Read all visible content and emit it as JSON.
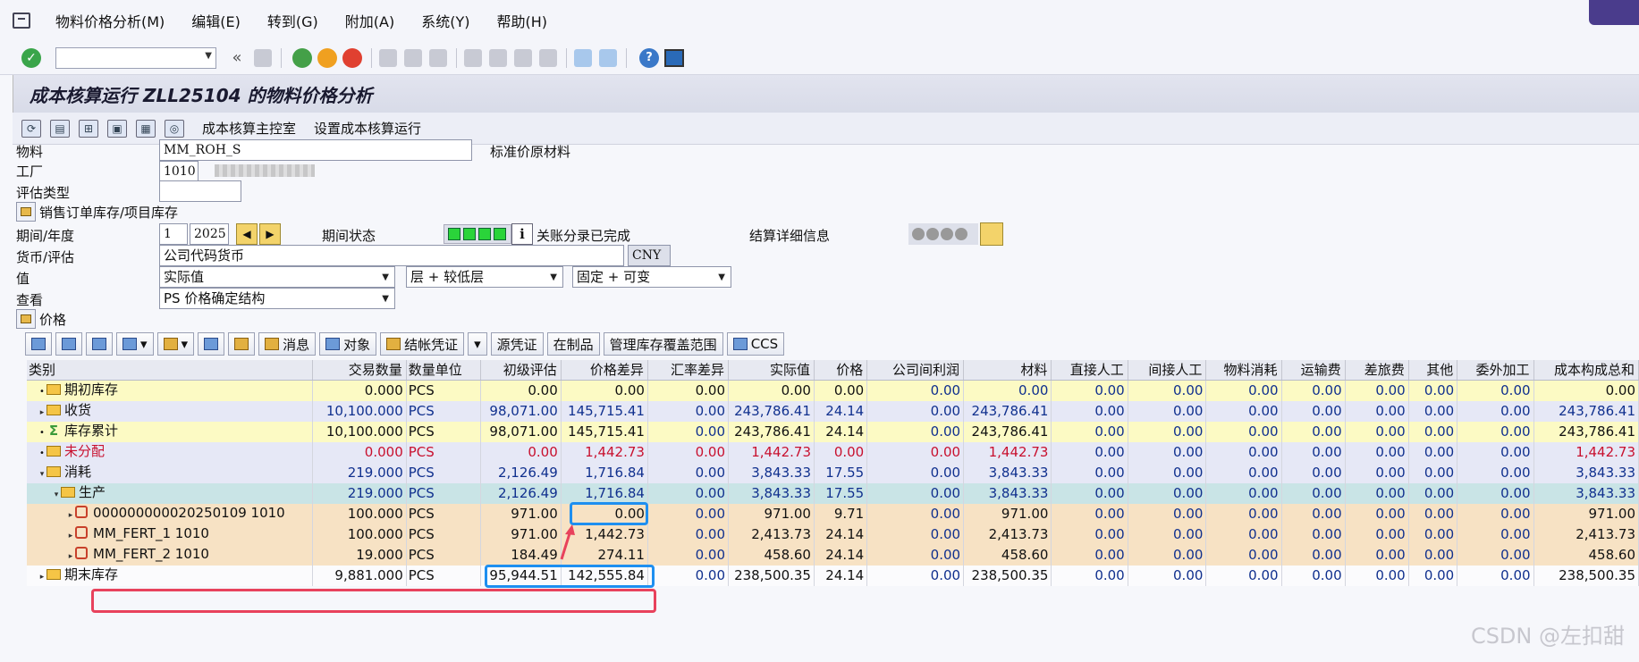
{
  "menubar": {
    "items": [
      "物料价格分析(M)",
      "编辑(E)",
      "转到(G)",
      "附加(A)",
      "系统(Y)",
      "帮助(H)"
    ]
  },
  "toolbar": {
    "back_symbol": "«"
  },
  "title": "成本核算运行 ZLL25104 的物料价格分析",
  "app_toolbar": {
    "cockpit": "成本核算主控室",
    "setup": "设置成本核算运行"
  },
  "form": {
    "material_label": "物料",
    "material_value": "MM_ROH_S",
    "material_desc": "标准价原材料",
    "plant_label": "工厂",
    "plant_value": "1010",
    "valuation_type_label": "评估类型",
    "valuation_type_value": "",
    "sales_order_stock": "销售订单库存/项目库存",
    "period_label": "期间/年度",
    "period_value": "1",
    "year_value": "2025",
    "period_status_label": "期间状态",
    "period_status_text": "关账分录已完成",
    "settlement_label": "结算详细信息",
    "currency_label": "货币/评估",
    "currency_value": "公司代码货币",
    "currency_code": "CNY",
    "value_label": "值",
    "value_select": "实际值",
    "level_select": "层 + 较低层",
    "fixvar_select": "固定 + 可变",
    "view_label": "查看",
    "view_select": "PS 价格确定结构",
    "price_node": "价格"
  },
  "alv_toolbar": {
    "messages": "消息",
    "objects": "对象",
    "settlement_doc": "结帐凭证",
    "source_doc": "源凭证",
    "wip": "在制品",
    "coverage": "管理库存覆盖范围",
    "ccs": "CCS"
  },
  "table": {
    "headers": [
      "类别",
      "交易数量",
      "数量单位",
      "初级评估",
      "价格差异",
      "汇率差异",
      "实际值",
      "价格",
      "公司间利润",
      "材料",
      "直接人工",
      "间接人工",
      "物料消耗",
      "运输费",
      "差旅费",
      "其他",
      "委外加工",
      "成本构成总和"
    ],
    "rows": [
      {
        "name": "期初库存",
        "qty": "0.000",
        "unit": "PCS",
        "prim": "0.00",
        "pdiff": "0.00",
        "xdiff": "0.00",
        "actual": "0.00",
        "price": "0.00",
        "ic": "0.00",
        "mat": "0.00",
        "dl": "0.00",
        "il": "0.00",
        "mc": "0.00",
        "tr": "0.00",
        "tv": "0.00",
        "oth": "0.00",
        "sub": "0.00",
        "sum": "0.00"
      },
      {
        "name": "收货",
        "qty": "10,100.000",
        "unit": "PCS",
        "prim": "98,071.00",
        "pdiff": "145,715.41",
        "xdiff": "0.00",
        "actual": "243,786.41",
        "price": "24.14",
        "ic": "0.00",
        "mat": "243,786.41",
        "dl": "0.00",
        "il": "0.00",
        "mc": "0.00",
        "tr": "0.00",
        "tv": "0.00",
        "oth": "0.00",
        "sub": "0.00",
        "sum": "243,786.41"
      },
      {
        "name": "库存累计",
        "qty": "10,100.000",
        "unit": "PCS",
        "prim": "98,071.00",
        "pdiff": "145,715.41",
        "xdiff": "0.00",
        "actual": "243,786.41",
        "price": "24.14",
        "ic": "0.00",
        "mat": "243,786.41",
        "dl": "0.00",
        "il": "0.00",
        "mc": "0.00",
        "tr": "0.00",
        "tv": "0.00",
        "oth": "0.00",
        "sub": "0.00",
        "sum": "243,786.41"
      },
      {
        "name": "未分配",
        "qty": "0.000",
        "unit": "PCS",
        "prim": "0.00",
        "pdiff": "1,442.73",
        "xdiff": "0.00",
        "actual": "1,442.73",
        "price": "0.00",
        "ic": "0.00",
        "mat": "1,442.73",
        "dl": "0.00",
        "il": "0.00",
        "mc": "0.00",
        "tr": "0.00",
        "tv": "0.00",
        "oth": "0.00",
        "sub": "0.00",
        "sum": "1,442.73"
      },
      {
        "name": "消耗",
        "qty": "219.000",
        "unit": "PCS",
        "prim": "2,126.49",
        "pdiff": "1,716.84",
        "xdiff": "0.00",
        "actual": "3,843.33",
        "price": "17.55",
        "ic": "0.00",
        "mat": "3,843.33",
        "dl": "0.00",
        "il": "0.00",
        "mc": "0.00",
        "tr": "0.00",
        "tv": "0.00",
        "oth": "0.00",
        "sub": "0.00",
        "sum": "3,843.33"
      },
      {
        "name": "生产",
        "qty": "219.000",
        "unit": "PCS",
        "prim": "2,126.49",
        "pdiff": "1,716.84",
        "xdiff": "0.00",
        "actual": "3,843.33",
        "price": "17.55",
        "ic": "0.00",
        "mat": "3,843.33",
        "dl": "0.00",
        "il": "0.00",
        "mc": "0.00",
        "tr": "0.00",
        "tv": "0.00",
        "oth": "0.00",
        "sub": "0.00",
        "sum": "3,843.33"
      },
      {
        "name": "000000000020250109 1010",
        "qty": "100.000",
        "unit": "PCS",
        "prim": "971.00",
        "pdiff": "0.00",
        "xdiff": "0.00",
        "actual": "971.00",
        "price": "9.71",
        "ic": "0.00",
        "mat": "971.00",
        "dl": "0.00",
        "il": "0.00",
        "mc": "0.00",
        "tr": "0.00",
        "tv": "0.00",
        "oth": "0.00",
        "sub": "0.00",
        "sum": "971.00"
      },
      {
        "name": "MM_FERT_1 1010",
        "qty": "100.000",
        "unit": "PCS",
        "prim": "971.00",
        "pdiff": "1,442.73",
        "xdiff": "0.00",
        "actual": "2,413.73",
        "price": "24.14",
        "ic": "0.00",
        "mat": "2,413.73",
        "dl": "0.00",
        "il": "0.00",
        "mc": "0.00",
        "tr": "0.00",
        "tv": "0.00",
        "oth": "0.00",
        "sub": "0.00",
        "sum": "2,413.73"
      },
      {
        "name": "MM_FERT_2 1010",
        "qty": "19.000",
        "unit": "PCS",
        "prim": "184.49",
        "pdiff": "274.11",
        "xdiff": "0.00",
        "actual": "458.60",
        "price": "24.14",
        "ic": "0.00",
        "mat": "458.60",
        "dl": "0.00",
        "il": "0.00",
        "mc": "0.00",
        "tr": "0.00",
        "tv": "0.00",
        "oth": "0.00",
        "sub": "0.00",
        "sum": "458.60"
      },
      {
        "name": "期末库存",
        "qty": "9,881.000",
        "unit": "PCS",
        "prim": "95,944.51",
        "pdiff": "142,555.84",
        "xdiff": "0.00",
        "actual": "238,500.35",
        "price": "24.14",
        "ic": "0.00",
        "mat": "238,500.35",
        "dl": "0.00",
        "il": "0.00",
        "mc": "0.00",
        "tr": "0.00",
        "tv": "0.00",
        "oth": "0.00",
        "sub": "0.00",
        "sum": "238,500.35"
      }
    ]
  },
  "watermark": "CSDN @左扣甜",
  "colors": {
    "highlight_blue": "#1e8ff0",
    "highlight_red": "#e8425c",
    "title_bg": "#dcdfeb"
  }
}
